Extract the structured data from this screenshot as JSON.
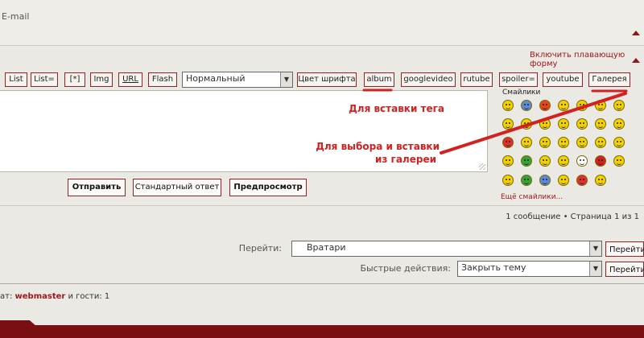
{
  "top": {
    "email_label": "E-mail"
  },
  "float_form_link": "Включить плавающую форму",
  "toolbar": {
    "buttons": [
      "List",
      "List=",
      "[*]",
      "Img",
      "URL",
      "Flash"
    ],
    "font_size_select": "Нормальный",
    "buttons2": [
      "Цвет шрифта",
      "album",
      "googlevideo",
      "rutube",
      "spoiler=",
      "youtube",
      "Галерея"
    ]
  },
  "smilies": {
    "title": "Смайлики",
    "more": "Ещё смайлики...",
    "colors": [
      "#f2d100",
      "#5a8ad8",
      "#e8451f",
      "#f2d100",
      "#f2d100",
      "#f2d100",
      "#f2d100",
      "#f2d100",
      "#f2d100",
      "#f2d100",
      "#f2d100",
      "#f2d100",
      "#f2d100",
      "#f2d100",
      "#e23030",
      "#f2d100",
      "#f2d100",
      "#f2d100",
      "#f2d100",
      "#f2d100",
      "#f2d100",
      "#f2d100",
      "#3aa23a",
      "#f2d100",
      "#f2d100",
      "#ffffff",
      "#d42020",
      "#f2d100",
      "#f2d100",
      "#3aa23a",
      "#5a8ad8",
      "#f2d100",
      "#e23030",
      "#f2d100"
    ]
  },
  "annotations": {
    "tag_hint": "Для вставки тега",
    "gallery_hint_line1": "Для выбора и вставки",
    "gallery_hint_line2": "из галереи",
    "color": "#d42020"
  },
  "actions": {
    "send": "Отправить",
    "standard_reply": "Стандартный ответ",
    "preview": "Предпросмотр"
  },
  "page_info": "1 сообщение • Страница 1 из 1",
  "jump": {
    "label": "Перейти:",
    "value": "Вратари",
    "button": "Перейти"
  },
  "quick": {
    "label": "Быстрые действия:",
    "value": "Закрыть тему",
    "button": "Перейти"
  },
  "online": {
    "prefix": "ат: ",
    "user": "webmaster",
    "suffix": " и гости: 1"
  },
  "colors": {
    "accent": "#a0181c",
    "footer": "#7a0f12",
    "background": "#ebe9e3"
  }
}
